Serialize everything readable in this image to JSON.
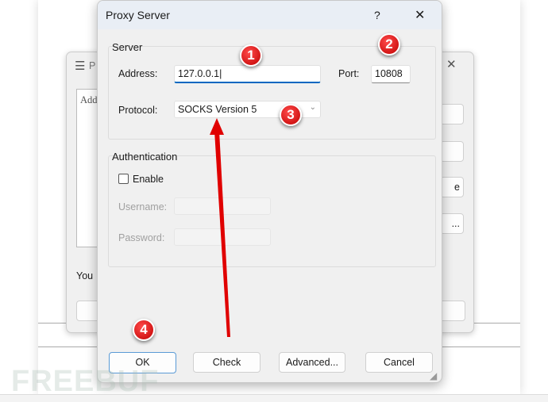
{
  "dialog": {
    "title": "Proxy Server",
    "help": "?",
    "close": "✕"
  },
  "background_window": {
    "title_fragment": "P",
    "text_fragment": "Add",
    "you_fragment": "You",
    "btn_fragment_1": "e",
    "btn_fragment_2": "..."
  },
  "server": {
    "group_label": "Server",
    "address_label": "Address:",
    "address_value": "127.0.0.1",
    "port_label": "Port:",
    "port_value": "10808",
    "protocol_label": "Protocol:",
    "protocol_value": "SOCKS Version 5"
  },
  "authentication": {
    "group_label": "Authentication",
    "enable_label": "Enable",
    "enabled": false,
    "username_label": "Username:",
    "username_value": "",
    "password_label": "Password:",
    "password_value": ""
  },
  "buttons": {
    "ok": "OK",
    "check": "Check",
    "advanced": "Advanced...",
    "cancel": "Cancel"
  },
  "annotations": {
    "badges": [
      "1",
      "2",
      "3",
      "4"
    ],
    "color": "#e00000"
  },
  "watermark": "FREEBUF"
}
